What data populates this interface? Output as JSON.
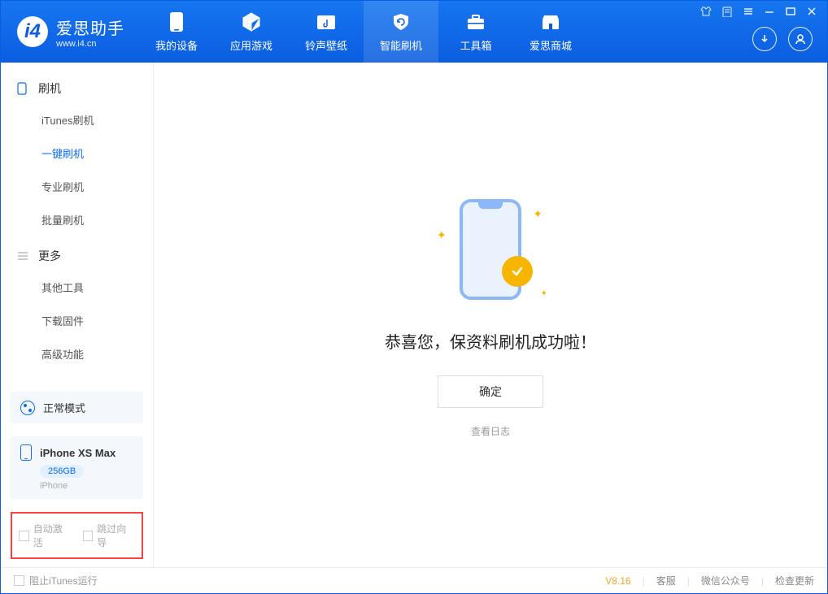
{
  "app": {
    "name": "爱思助手",
    "url": "www.i4.cn"
  },
  "tabs": [
    {
      "label": "我的设备"
    },
    {
      "label": "应用游戏"
    },
    {
      "label": "铃声壁纸"
    },
    {
      "label": "智能刷机"
    },
    {
      "label": "工具箱"
    },
    {
      "label": "爱思商城"
    }
  ],
  "sidebar": {
    "flash_header": "刷机",
    "flash_items": [
      "iTunes刷机",
      "一键刷机",
      "专业刷机",
      "批量刷机"
    ],
    "more_header": "更多",
    "more_items": [
      "其他工具",
      "下载固件",
      "高级功能"
    ]
  },
  "mode": {
    "label": "正常模式"
  },
  "device": {
    "name": "iPhone XS Max",
    "capacity": "256GB",
    "type": "iPhone"
  },
  "options": {
    "auto_activate": "自动激活",
    "skip_guide": "跳过向导"
  },
  "main": {
    "success_title": "恭喜您，保资料刷机成功啦！",
    "ok_button": "确定",
    "view_log": "查看日志"
  },
  "footer": {
    "block_itunes": "阻止iTunes运行",
    "version": "V8.16",
    "support": "客服",
    "wechat": "微信公众号",
    "check_update": "检查更新"
  }
}
